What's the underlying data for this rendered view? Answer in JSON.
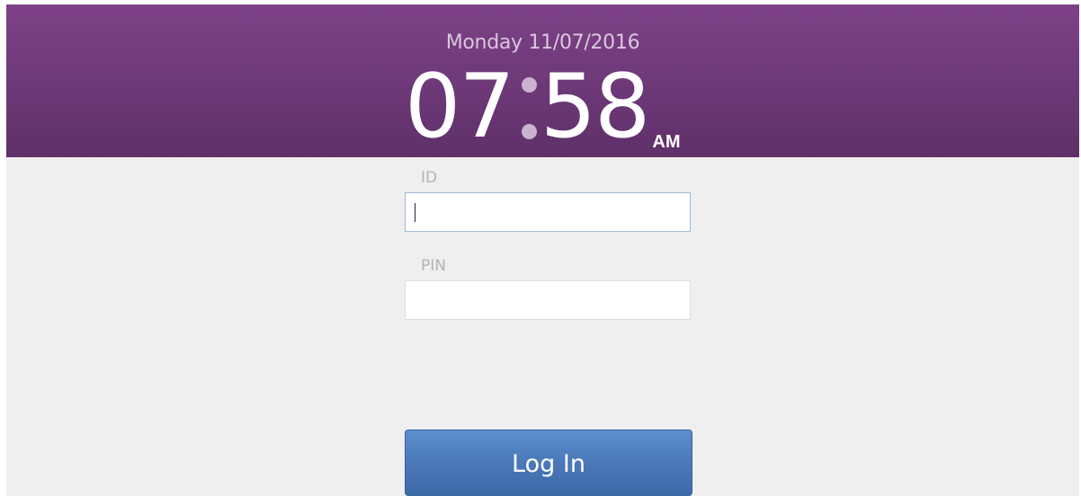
{
  "header": {
    "date": "Monday 11/07/2016",
    "time_hour": "07",
    "time_minute": "58",
    "time_period": "AM"
  },
  "form": {
    "id_label": "ID",
    "id_value": "",
    "pin_label": "PIN",
    "pin_value": "",
    "login_label": "Log In"
  },
  "colors": {
    "header_purple": "#6d3878",
    "button_blue": "#4a78b8",
    "background": "#efefef"
  },
  "icons": {
    "colon": "clock-colon-dots"
  }
}
